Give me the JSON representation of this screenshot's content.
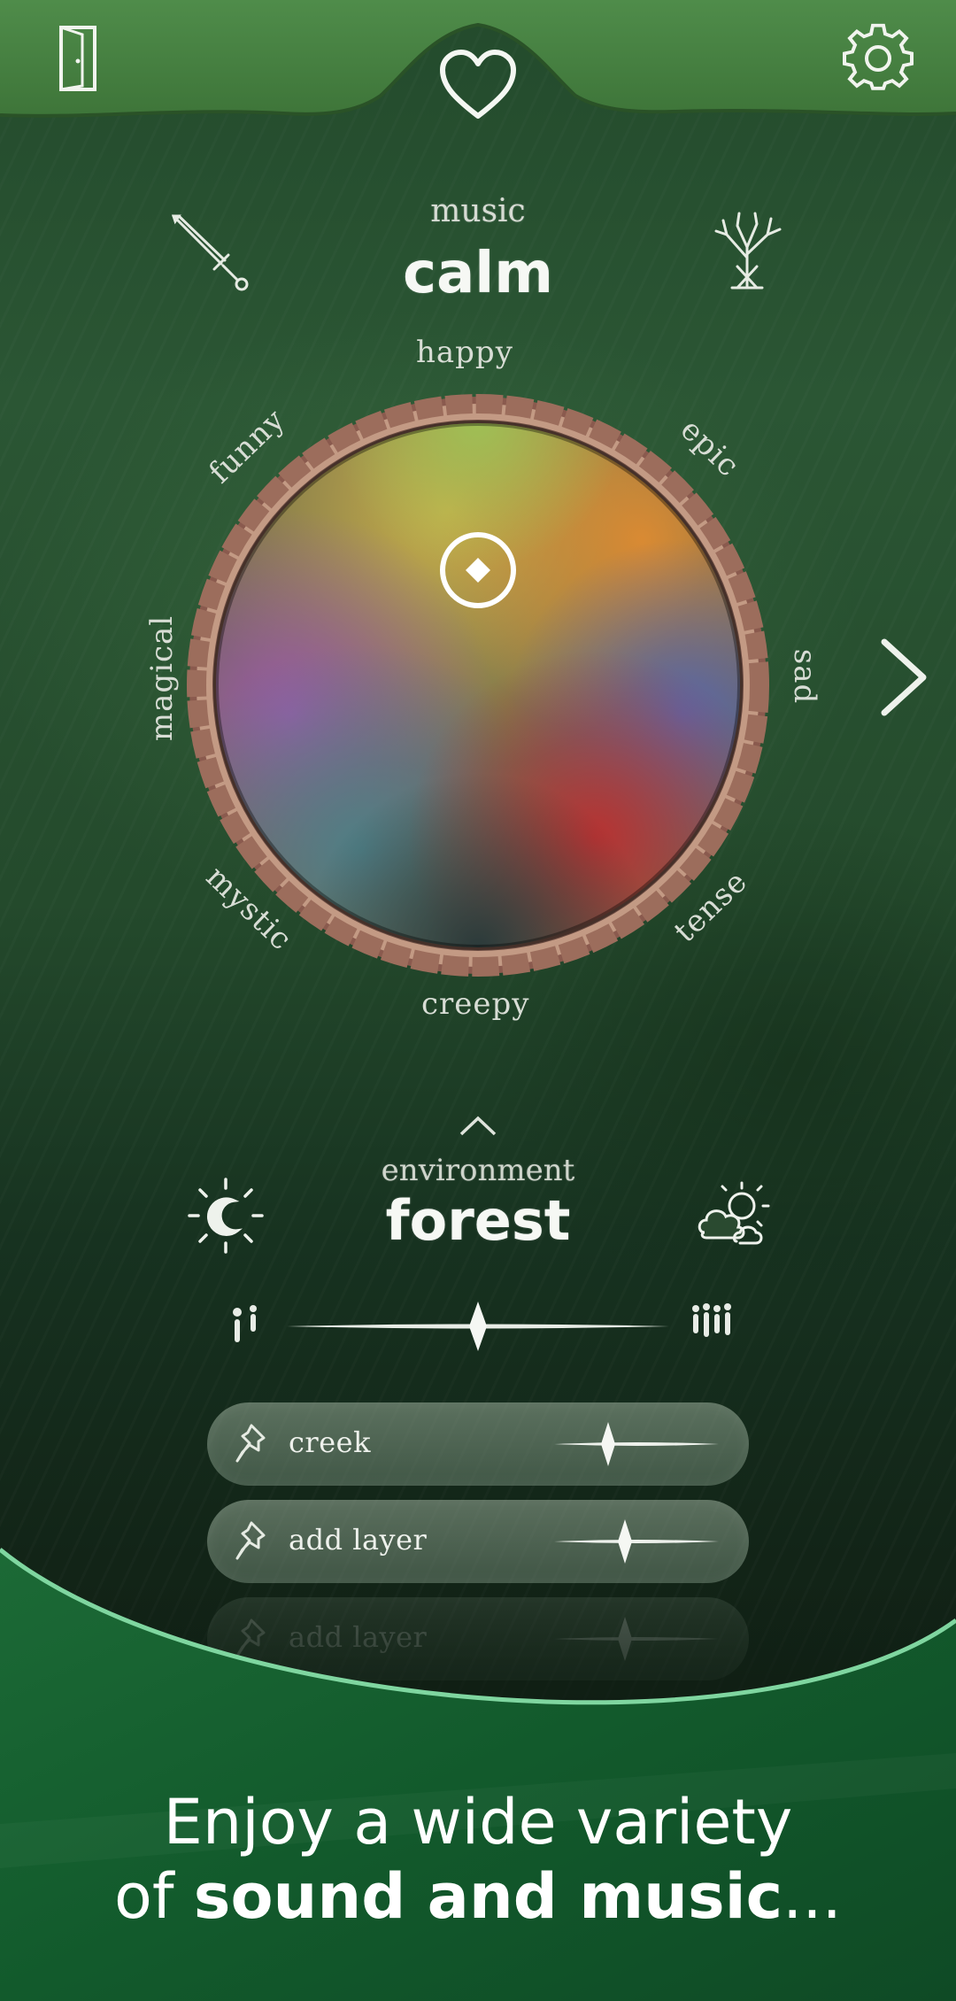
{
  "header": {
    "exit_icon": "door-icon",
    "favorite_icon": "heart-icon",
    "settings_icon": "gear-icon"
  },
  "music": {
    "section_label": "music",
    "current_mood": "calm",
    "left_icon": "sword-icon",
    "right_icon": "tree-icon",
    "moods": [
      "happy",
      "epic",
      "sad",
      "tense",
      "creepy",
      "mystic",
      "magical",
      "funny"
    ],
    "next_icon": "chevron-right-icon"
  },
  "environment": {
    "section_label": "environment",
    "current": "forest",
    "left_icon": "day-night-icon",
    "right_icon": "weather-icon",
    "intensity_low_icon": "sparse-drops-icon",
    "intensity_high_icon": "dense-drops-icon",
    "intensity_level": 0.5,
    "collapse_icon": "chevron-up-icon",
    "layers": [
      {
        "label": "creek",
        "volume": 0.33
      },
      {
        "label": "add layer",
        "volume": 0.43
      },
      {
        "label": "add layer",
        "volume": 0.43
      }
    ]
  },
  "tagline": {
    "line1": "Enjoy a wide variety",
    "line2_prefix": "of ",
    "line2_bold": "sound and music",
    "line2_suffix": "..."
  }
}
